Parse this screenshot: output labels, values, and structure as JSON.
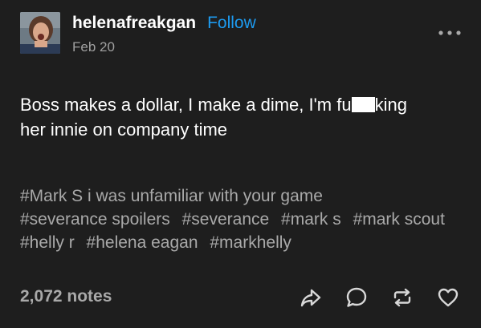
{
  "post": {
    "username": "helenafreakgan",
    "follow_label": "Follow",
    "date": "Feb 20",
    "body": {
      "part1": "Boss makes a dollar, I make a dime, I'm fu",
      "part2": "king",
      "line2": "her innie on company time"
    },
    "tags": [
      "#Mark S i was unfamiliar with your game",
      "#severance spoilers",
      "#severance",
      "#mark s",
      "#mark scout",
      "#helly r",
      "#helena eagan",
      "#markhelly"
    ],
    "notes": "2,072 notes"
  },
  "icons": {
    "more": "more-options-icon",
    "share": "share-icon",
    "reply": "reply-icon",
    "reblog": "reblog-icon",
    "like": "heart-icon"
  },
  "colors": {
    "background": "#1e1e1e",
    "text": "#ffffff",
    "muted": "#a9a9a9",
    "follow": "#1d9bf0"
  }
}
